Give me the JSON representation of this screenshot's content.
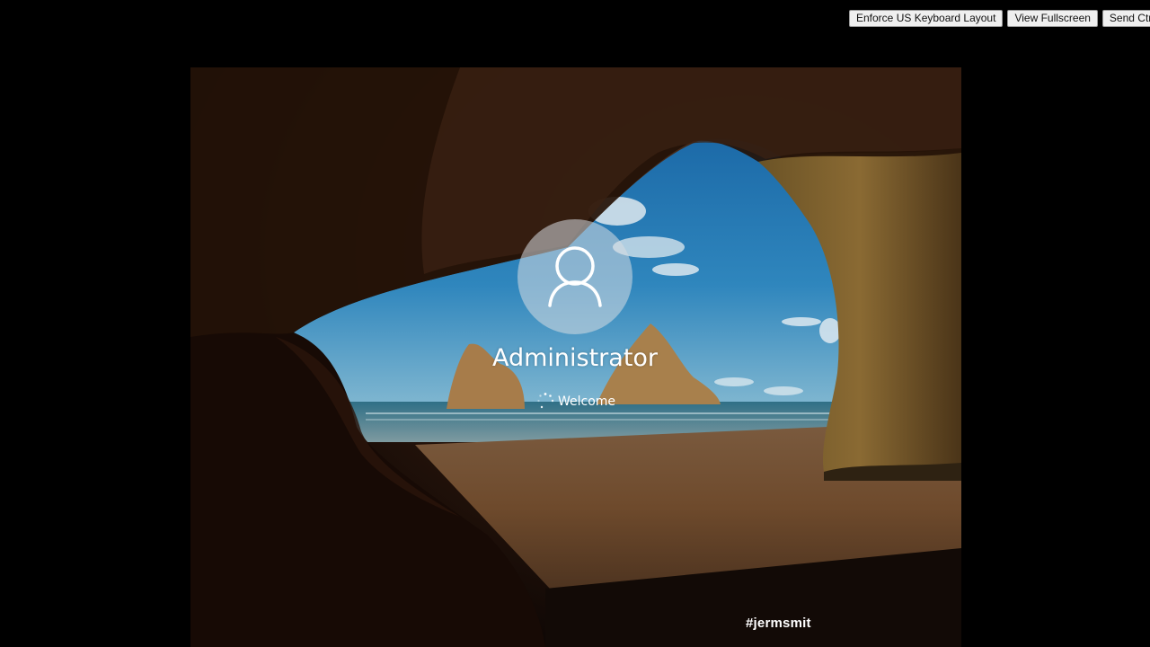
{
  "toolbar": {
    "buttons": [
      {
        "label": "Enforce US Keyboard Layout"
      },
      {
        "label": "View Fullscreen"
      },
      {
        "label": "Send Ctrl-Alt-Del"
      }
    ]
  },
  "login": {
    "avatar_icon": "user-icon",
    "username": "Administrator",
    "status_icon": "spinner-icon",
    "status_text": "Welcome"
  },
  "watermark": {
    "text": "#jermsmit"
  },
  "colors": {
    "page_background": "#000000",
    "text": "#ffffff",
    "button_face": "#efefef"
  }
}
